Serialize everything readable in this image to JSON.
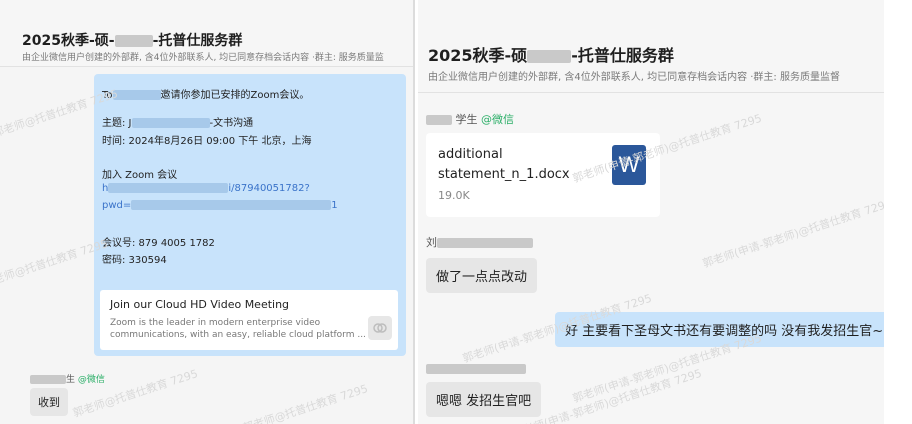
{
  "left": {
    "title_prefix": "2025秋季-硕-",
    "title_suffix": "-托普仕服务群",
    "subtitle": "由企业微信用户创建的外部群, 含4位外部联系人, 均已同意存档会话内容 ·群主: 服务质量监",
    "invite": {
      "greeting_start": "To",
      "greeting_end": "邀请你参加已安排的Zoom会议。",
      "topic_label": "主题: J",
      "topic_end": "-文书沟通",
      "time": "时间: 2024年8月26日 09:00 下午 北京，上海",
      "join_label": "加入 Zoom 会议",
      "link_start": "h",
      "link_end": "i/87940051782?",
      "pwd_start": "pwd=",
      "pwd_end": "1",
      "meeting_id": "会议号: 879 4005 1782",
      "passcode": "密码: 330594",
      "card_title": "Join our Cloud HD Video Meeting",
      "card_desc_1": "Zoom is the leader in modern enterprise video",
      "card_desc_2": "communications, with an easy, reliable cloud platform ..."
    },
    "sender2_end": "生",
    "sender2_at": "@微信",
    "reply": "收到",
    "watermark": "郭老师@托普仕教育 7295"
  },
  "right": {
    "title_prefix": "2025秋季-硕",
    "title_suffix": "-托普仕服务群",
    "subtitle": "由企业微信用户创建的外部群, 含4位外部联系人, 均已同意存档会话内容 ·群主: 服务质量监督",
    "sender1_end": "学生",
    "sender1_at": "@微信",
    "file": {
      "name_1": "additional",
      "name_2": "statement_n_1.docx",
      "size": "19.0K",
      "icon": "W"
    },
    "sender2_start": "刘",
    "msg1": "做了一点点改动",
    "msg2": "好 主要看下圣母文书还有要调整的吗 没有我发招生官~",
    "msg3": "嗯嗯 发招生官吧",
    "watermark": "郭老师(申请-郭老师)@托普仕教育 7295"
  }
}
